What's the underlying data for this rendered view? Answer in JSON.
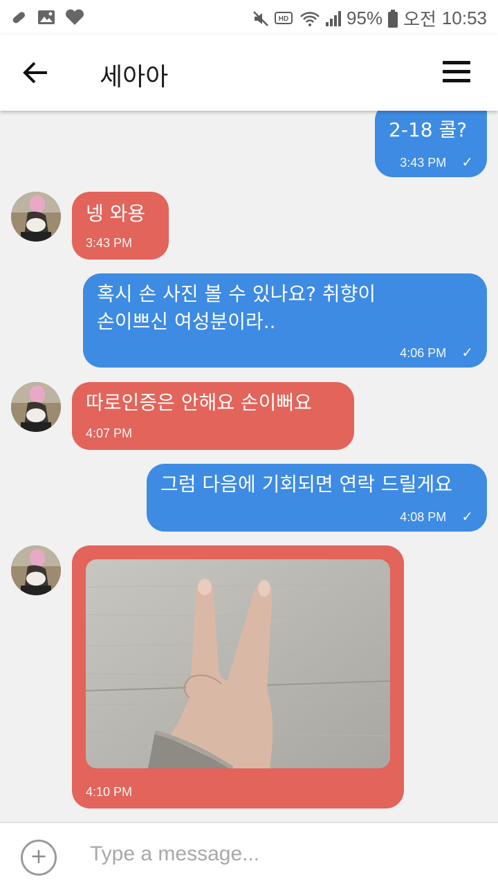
{
  "status_bar": {
    "battery": "95%",
    "period": "오전",
    "time": "10:53",
    "icons": [
      "pill-icon",
      "image-icon",
      "heart-app-icon",
      "mute-icon",
      "hd-icon",
      "wifi-icon",
      "signal-icon",
      "battery-icon"
    ]
  },
  "header": {
    "title": "세아아"
  },
  "messages": [
    {
      "dir": "out",
      "text": "2-18 콜?",
      "time": "3:43 PM",
      "check": "✓"
    },
    {
      "dir": "in",
      "text": "넹 와용",
      "time": "3:43 PM"
    },
    {
      "dir": "out",
      "text": "혹시 손 사진 볼 수 있나요? 취향이\n손이쁘신 여성분이라..",
      "time": "4:06 PM",
      "check": "✓"
    },
    {
      "dir": "in",
      "text": "따로인증은 안해요 손이뻐요",
      "time": "4:07 PM"
    },
    {
      "dir": "out",
      "text": "그럼 다음에 기회되면 연락 드릴게요",
      "time": "4:08 PM",
      "check": "✓"
    },
    {
      "dir": "in",
      "image": "photo of a hand making a V sign",
      "time": "4:10 PM"
    }
  ],
  "input": {
    "placeholder": "Type a message..."
  },
  "colors": {
    "outgoing": "#3d8be3",
    "incoming": "#e2645a",
    "background": "#f1f1f1"
  }
}
